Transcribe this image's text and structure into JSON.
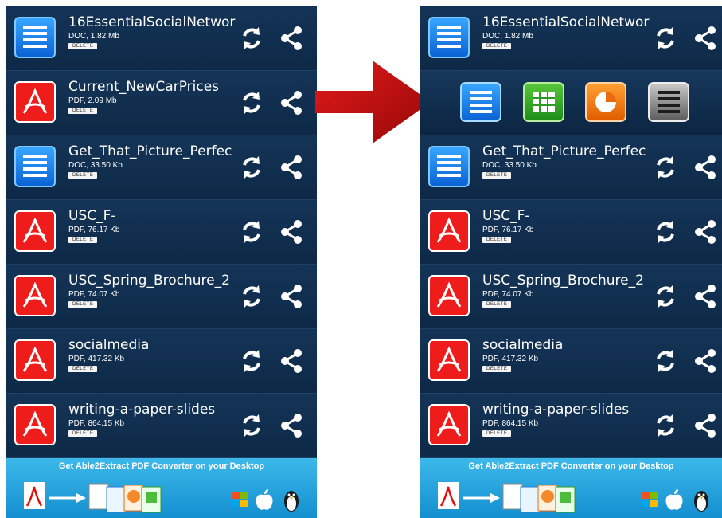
{
  "files": [
    {
      "name": "16EssentialSocialNetwor",
      "meta": "DOC, 1.82 Mb",
      "type": "doc"
    },
    {
      "name": "Current_NewCarPrices",
      "meta": "PDF, 2.09 Mb",
      "type": "pdf"
    },
    {
      "name": "Get_That_Picture_Perfec",
      "meta": "DOC, 33.50 Kb",
      "type": "doc"
    },
    {
      "name": "USC_F-",
      "meta": "PDF, 76.17 Kb",
      "type": "pdf"
    },
    {
      "name": "USC_Spring_Brochure_2",
      "meta": "PDF, 74.07 Kb",
      "type": "pdf"
    },
    {
      "name": "socialmedia",
      "meta": "PDF, 417.32 Kb",
      "type": "pdf"
    },
    {
      "name": "writing-a-paper-slides",
      "meta": "PDF, 864.15 Kb",
      "type": "pdf"
    }
  ],
  "delete_label": "DELETE",
  "banner_text": "Get Able2Extract PDF Converter on your Desktop",
  "convert_options": [
    "word-doc-icon",
    "excel-xls-icon",
    "powerpoint-ppt-icon",
    "text-txt-icon"
  ],
  "colors": {
    "background": "#0f2a48",
    "banner": "#2aa8e2",
    "pdf_red": "#ef1c1c",
    "doc_blue": "#1a86ee",
    "arrow": "#c10f0f"
  }
}
